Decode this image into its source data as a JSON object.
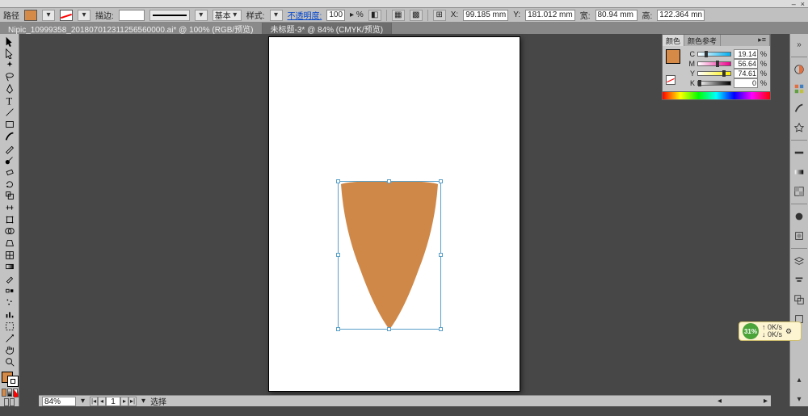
{
  "menu": {
    "minimize": "–",
    "close": "×"
  },
  "control_bar": {
    "selection_label": "路径",
    "stroke_label": "描边:",
    "stroke_dash_value": "",
    "brush_label": "基本",
    "style_label": "样式:",
    "opacity_label": "不透明度:",
    "opacity_value": "100",
    "opacity_unit": "▸ %",
    "x_label": "X:",
    "x_value": "99.185 mm",
    "y_label": "Y:",
    "y_value": "181.012 mm",
    "w_label": "宽:",
    "w_value": "80.94 mm",
    "h_label": "高:",
    "h_value": "122.364 mn"
  },
  "tabs": {
    "items": [
      {
        "label": "Nipic_10999358_201807012311256560000.ai* @ 100%  (RGB/预览)"
      },
      {
        "label": "未标题-3* @ 84% (CMYK/预览)"
      }
    ]
  },
  "status": {
    "zoom": "84%",
    "page": "1",
    "select_label": "选择"
  },
  "color_panel": {
    "tab1": "颜色",
    "tab2": "颜色参考",
    "channels": {
      "c": {
        "label": "C",
        "value": "19.14",
        "thumb_pct": 19
      },
      "m": {
        "label": "M",
        "value": "56.64",
        "thumb_pct": 56
      },
      "y": {
        "label": "Y",
        "value": "74.61",
        "thumb_pct": 74
      },
      "k": {
        "label": "K",
        "value": "0",
        "thumb_pct": 0
      }
    },
    "pct_sign": "%"
  },
  "indicator": {
    "percent": "31%",
    "line1": "0K/s",
    "line2": "0K/s"
  },
  "toolbox": {
    "icons": [
      "selection",
      "direct-selection",
      "magic-wand",
      "lasso",
      "pen",
      "type",
      "line",
      "rectangle",
      "paintbrush",
      "pencil",
      "blob",
      "eraser",
      "rotate",
      "scale",
      "width",
      "free-transform",
      "shape-builder",
      "perspective",
      "mesh",
      "gradient",
      "eyedropper",
      "blend",
      "symbol-sprayer",
      "column-graph",
      "artboard",
      "slice",
      "hand",
      "zoom"
    ]
  },
  "right_dock": {
    "icons": [
      "color-picker",
      "swatches",
      "brushes",
      "symbols",
      "stroke",
      "gradient",
      "transparency",
      "appearance",
      "graphic-styles",
      "layers",
      "align",
      "pathfinder",
      "transform",
      "document"
    ]
  }
}
